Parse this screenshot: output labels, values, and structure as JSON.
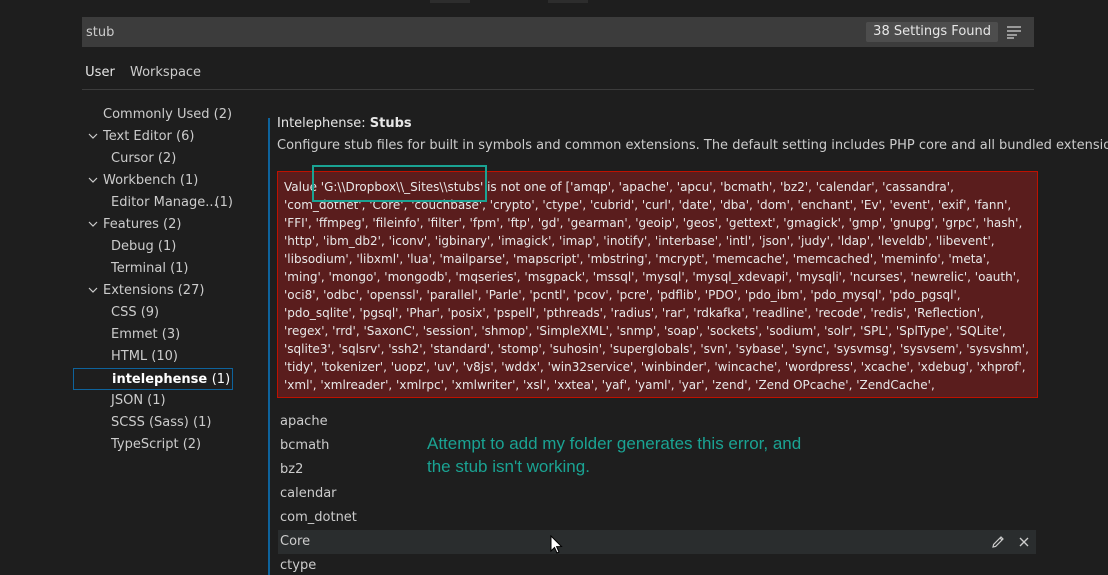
{
  "search": {
    "value": "stub",
    "results_count": "38 Settings Found",
    "filter_icon": "filter-icon"
  },
  "tabs": [
    {
      "label": "User",
      "active": true
    },
    {
      "label": "Workspace",
      "active": false
    }
  ],
  "toc": {
    "items": [
      {
        "label": "Commonly Used (2)",
        "level": 1,
        "expanded": null
      },
      {
        "label": "Text Editor (6)",
        "level": 1,
        "expanded": true
      },
      {
        "label": "Cursor (2)",
        "level": 2
      },
      {
        "label": "Workbench (1)",
        "level": 1,
        "expanded": true
      },
      {
        "label": "Editor Manage...",
        "count": "(1)",
        "level": 2
      },
      {
        "label": "Features (2)",
        "level": 1,
        "expanded": true
      },
      {
        "label": "Debug (1)",
        "level": 2
      },
      {
        "label": "Terminal (1)",
        "level": 2
      },
      {
        "label": "Extensions (27)",
        "level": 1,
        "expanded": true
      },
      {
        "label": "CSS (9)",
        "level": 2
      },
      {
        "label": "Emmet (3)",
        "level": 2
      },
      {
        "label": "HTML (10)",
        "level": 2
      },
      {
        "label": "intelephense",
        "count": "(1)",
        "level": 2,
        "selected": true
      },
      {
        "label": "JSON (1)",
        "level": 2
      },
      {
        "label": "SCSS (Sass) (1)",
        "level": 2
      },
      {
        "label": "TypeScript (2)",
        "level": 2
      }
    ]
  },
  "setting": {
    "category": "Intelephense: ",
    "name": "Stubs",
    "description": "Configure stub files for built in symbols and common extensions. The default setting includes PHP core and all bundled extensions.",
    "error": "Value 'G:\\\\Dropbox\\\\_Sites\\\\stubs' is not one of ['amqp', 'apache', 'apcu', 'bcmath', 'bz2', 'calendar', 'cassandra', 'com_dotnet', 'Core', 'couchbase', 'crypto', 'ctype', 'cubrid', 'curl', 'date', 'dba', 'dom', 'enchant', 'Ev', 'event', 'exif', 'fann', 'FFI', 'ffmpeg', 'fileinfo', 'filter', 'fpm', 'ftp', 'gd', 'gearman', 'geoip', 'geos', 'gettext', 'gmagick', 'gmp', 'gnupg', 'grpc', 'hash', 'http', 'ibm_db2', 'iconv', 'igbinary', 'imagick', 'imap', 'inotify', 'interbase', 'intl', 'json', 'judy', 'ldap', 'leveldb', 'libevent', 'libsodium', 'libxml', 'lua', 'mailparse', 'mapscript', 'mbstring', 'mcrypt', 'memcache', 'memcached', 'meminfo', 'meta', 'ming', 'mongo', 'mongodb', 'mqseries', 'msgpack', 'mssql', 'mysql', 'mysql_xdevapi', 'mysqli', 'ncurses', 'newrelic', 'oauth', 'oci8', 'odbc', 'openssl', 'parallel', 'Parle', 'pcntl', 'pcov', 'pcre', 'pdflib', 'PDO', 'pdo_ibm', 'pdo_mysql', 'pdo_pgsql', 'pdo_sqlite', 'pgsql', 'Phar', 'posix', 'pspell', 'pthreads', 'radius', 'rar', 'rdkafka', 'readline', 'recode', 'redis', 'Reflection', 'regex', 'rrd', 'SaxonC', 'session', 'shmop', 'SimpleXML', 'snmp', 'soap', 'sockets', 'sodium', 'solr', 'SPL', 'SplType', 'SQLite', 'sqlite3', 'sqlsrv', 'ssh2', 'standard', 'stomp', 'suhosin', 'superglobals', 'svn', 'sybase', 'sync', 'sysvmsg', 'sysvsem', 'sysvshm', 'tidy', 'tokenizer', 'uopz', 'uv', 'v8js', 'wddx', 'win32service', 'winbinder', 'wincache', 'wordpress', 'xcache', 'xdebug', 'xhprof', 'xml', 'xmlreader', 'xmlrpc', 'xmlwriter', 'xsl', 'xxtea', 'yaf', 'yaml', 'yar', 'zend', 'Zend OPcache', 'ZendCache', 'ZendDebugger', 'ZendUtils', 'zip', 'zlib', 'zmq', 'zookeeper']",
    "list_items": [
      "apache",
      "bcmath",
      "bz2",
      "calendar",
      "com_dotnet",
      "Core",
      "ctype"
    ],
    "hovered_item_icons": [
      "edit-icon",
      "remove-icon"
    ]
  },
  "annotation": {
    "line1": "Attempt to add my folder generates this error, and",
    "line2": "the stub isn't working."
  },
  "colors": {
    "accent_focus": "#0e639c",
    "error_bg": "#5a1d1d",
    "error_border": "#be1100",
    "annotation": "#1aa393"
  }
}
